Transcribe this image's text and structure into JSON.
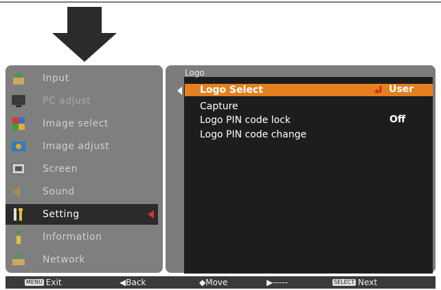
{
  "menu": {
    "items": [
      {
        "label": "Input",
        "icon": "input-icon"
      },
      {
        "label": "PC adjust",
        "icon": "monitor-icon"
      },
      {
        "label": "Image select",
        "icon": "image-select-icon"
      },
      {
        "label": "Image adjust",
        "icon": "image-adjust-icon"
      },
      {
        "label": "Screen",
        "icon": "screen-icon"
      },
      {
        "label": "Sound",
        "icon": "speaker-icon"
      },
      {
        "label": "Setting",
        "icon": "wrench-icon"
      },
      {
        "label": "Information",
        "icon": "info-icon"
      },
      {
        "label": "Network",
        "icon": "network-icon"
      }
    ]
  },
  "submenu": {
    "title": "Logo",
    "rows": [
      {
        "label": "Logo Select",
        "value": "User"
      },
      {
        "label": "Capture",
        "value": ""
      },
      {
        "label": "Logo PIN code lock",
        "value": "Off"
      },
      {
        "label": "Logo PIN code change",
        "value": ""
      }
    ]
  },
  "statusbar": {
    "exit_key": "MENU",
    "exit": "Exit",
    "back": "◀Back",
    "move": "◆Move",
    "next_arrow": "▶-----",
    "select_key": "SELECT",
    "next": "Next"
  },
  "colors": {
    "accent": "#e4801f",
    "indicator": "#e0302a"
  }
}
